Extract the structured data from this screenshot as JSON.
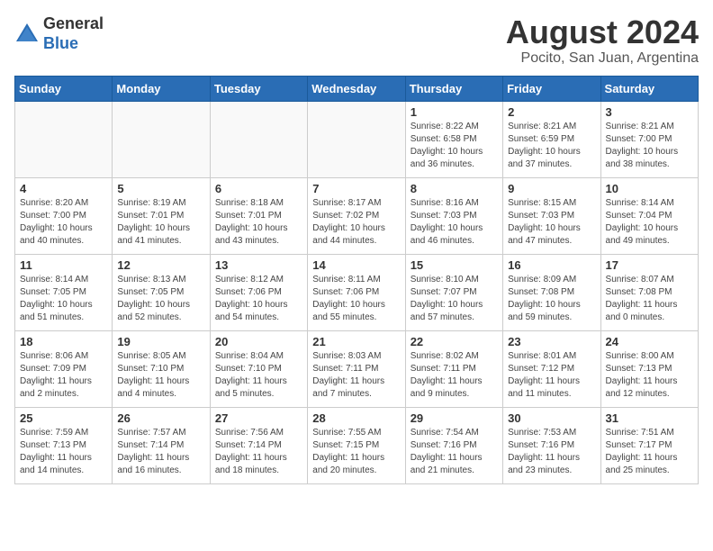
{
  "header": {
    "logo_general": "General",
    "logo_blue": "Blue",
    "month_year": "August 2024",
    "location": "Pocito, San Juan, Argentina"
  },
  "weekdays": [
    "Sunday",
    "Monday",
    "Tuesday",
    "Wednesday",
    "Thursday",
    "Friday",
    "Saturday"
  ],
  "weeks": [
    [
      {
        "day": "",
        "info": ""
      },
      {
        "day": "",
        "info": ""
      },
      {
        "day": "",
        "info": ""
      },
      {
        "day": "",
        "info": ""
      },
      {
        "day": "1",
        "info": "Sunrise: 8:22 AM\nSunset: 6:58 PM\nDaylight: 10 hours\nand 36 minutes."
      },
      {
        "day": "2",
        "info": "Sunrise: 8:21 AM\nSunset: 6:59 PM\nDaylight: 10 hours\nand 37 minutes."
      },
      {
        "day": "3",
        "info": "Sunrise: 8:21 AM\nSunset: 7:00 PM\nDaylight: 10 hours\nand 38 minutes."
      }
    ],
    [
      {
        "day": "4",
        "info": "Sunrise: 8:20 AM\nSunset: 7:00 PM\nDaylight: 10 hours\nand 40 minutes."
      },
      {
        "day": "5",
        "info": "Sunrise: 8:19 AM\nSunset: 7:01 PM\nDaylight: 10 hours\nand 41 minutes."
      },
      {
        "day": "6",
        "info": "Sunrise: 8:18 AM\nSunset: 7:01 PM\nDaylight: 10 hours\nand 43 minutes."
      },
      {
        "day": "7",
        "info": "Sunrise: 8:17 AM\nSunset: 7:02 PM\nDaylight: 10 hours\nand 44 minutes."
      },
      {
        "day": "8",
        "info": "Sunrise: 8:16 AM\nSunset: 7:03 PM\nDaylight: 10 hours\nand 46 minutes."
      },
      {
        "day": "9",
        "info": "Sunrise: 8:15 AM\nSunset: 7:03 PM\nDaylight: 10 hours\nand 47 minutes."
      },
      {
        "day": "10",
        "info": "Sunrise: 8:14 AM\nSunset: 7:04 PM\nDaylight: 10 hours\nand 49 minutes."
      }
    ],
    [
      {
        "day": "11",
        "info": "Sunrise: 8:14 AM\nSunset: 7:05 PM\nDaylight: 10 hours\nand 51 minutes."
      },
      {
        "day": "12",
        "info": "Sunrise: 8:13 AM\nSunset: 7:05 PM\nDaylight: 10 hours\nand 52 minutes."
      },
      {
        "day": "13",
        "info": "Sunrise: 8:12 AM\nSunset: 7:06 PM\nDaylight: 10 hours\nand 54 minutes."
      },
      {
        "day": "14",
        "info": "Sunrise: 8:11 AM\nSunset: 7:06 PM\nDaylight: 10 hours\nand 55 minutes."
      },
      {
        "day": "15",
        "info": "Sunrise: 8:10 AM\nSunset: 7:07 PM\nDaylight: 10 hours\nand 57 minutes."
      },
      {
        "day": "16",
        "info": "Sunrise: 8:09 AM\nSunset: 7:08 PM\nDaylight: 10 hours\nand 59 minutes."
      },
      {
        "day": "17",
        "info": "Sunrise: 8:07 AM\nSunset: 7:08 PM\nDaylight: 11 hours\nand 0 minutes."
      }
    ],
    [
      {
        "day": "18",
        "info": "Sunrise: 8:06 AM\nSunset: 7:09 PM\nDaylight: 11 hours\nand 2 minutes."
      },
      {
        "day": "19",
        "info": "Sunrise: 8:05 AM\nSunset: 7:10 PM\nDaylight: 11 hours\nand 4 minutes."
      },
      {
        "day": "20",
        "info": "Sunrise: 8:04 AM\nSunset: 7:10 PM\nDaylight: 11 hours\nand 5 minutes."
      },
      {
        "day": "21",
        "info": "Sunrise: 8:03 AM\nSunset: 7:11 PM\nDaylight: 11 hours\nand 7 minutes."
      },
      {
        "day": "22",
        "info": "Sunrise: 8:02 AM\nSunset: 7:11 PM\nDaylight: 11 hours\nand 9 minutes."
      },
      {
        "day": "23",
        "info": "Sunrise: 8:01 AM\nSunset: 7:12 PM\nDaylight: 11 hours\nand 11 minutes."
      },
      {
        "day": "24",
        "info": "Sunrise: 8:00 AM\nSunset: 7:13 PM\nDaylight: 11 hours\nand 12 minutes."
      }
    ],
    [
      {
        "day": "25",
        "info": "Sunrise: 7:59 AM\nSunset: 7:13 PM\nDaylight: 11 hours\nand 14 minutes."
      },
      {
        "day": "26",
        "info": "Sunrise: 7:57 AM\nSunset: 7:14 PM\nDaylight: 11 hours\nand 16 minutes."
      },
      {
        "day": "27",
        "info": "Sunrise: 7:56 AM\nSunset: 7:14 PM\nDaylight: 11 hours\nand 18 minutes."
      },
      {
        "day": "28",
        "info": "Sunrise: 7:55 AM\nSunset: 7:15 PM\nDaylight: 11 hours\nand 20 minutes."
      },
      {
        "day": "29",
        "info": "Sunrise: 7:54 AM\nSunset: 7:16 PM\nDaylight: 11 hours\nand 21 minutes."
      },
      {
        "day": "30",
        "info": "Sunrise: 7:53 AM\nSunset: 7:16 PM\nDaylight: 11 hours\nand 23 minutes."
      },
      {
        "day": "31",
        "info": "Sunrise: 7:51 AM\nSunset: 7:17 PM\nDaylight: 11 hours\nand 25 minutes."
      }
    ]
  ]
}
